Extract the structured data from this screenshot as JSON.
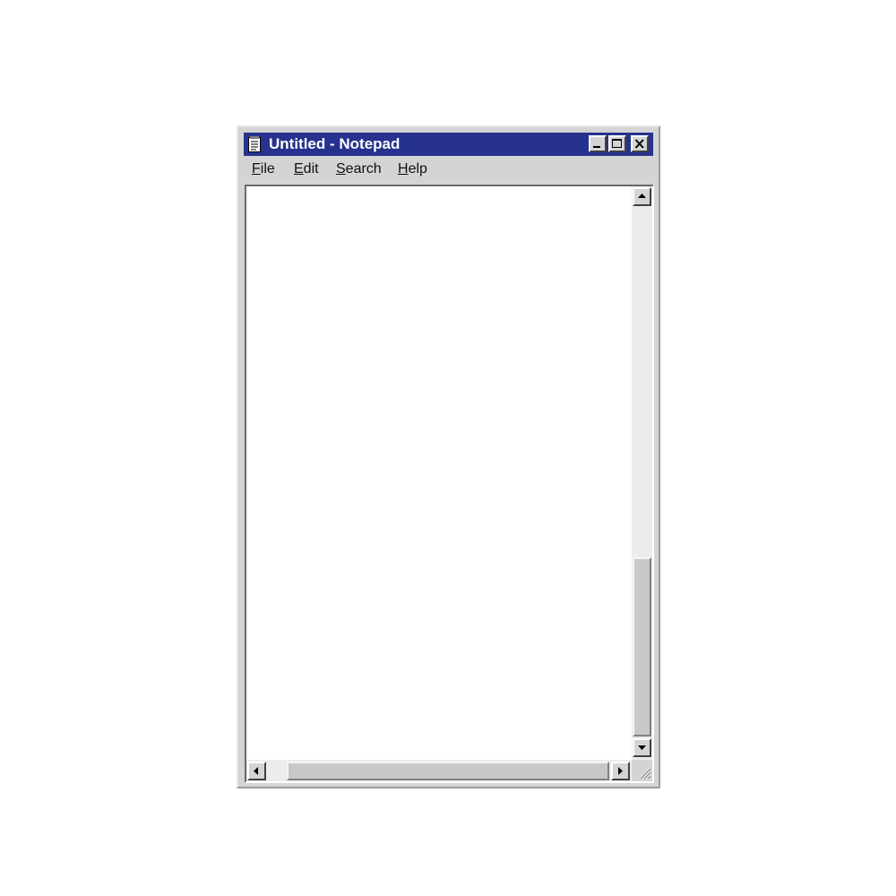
{
  "window": {
    "title": "Untitled - Notepad"
  },
  "controls": {
    "minimize": "minimize-icon",
    "maximize": "maximize-icon",
    "close": "close-icon"
  },
  "menu": {
    "items": [
      {
        "label": "File",
        "accel": "F",
        "rest": "ile"
      },
      {
        "label": "Edit",
        "accel": "E",
        "rest": "dit"
      },
      {
        "label": "Search",
        "accel": "S",
        "rest": "earch"
      },
      {
        "label": "Help",
        "accel": "H",
        "rest": "elp"
      }
    ]
  },
  "editor": {
    "content": ""
  },
  "colors": {
    "titlebar": "#26328e",
    "chrome": "#d4d4d4",
    "editor_bg": "#ffffff"
  }
}
